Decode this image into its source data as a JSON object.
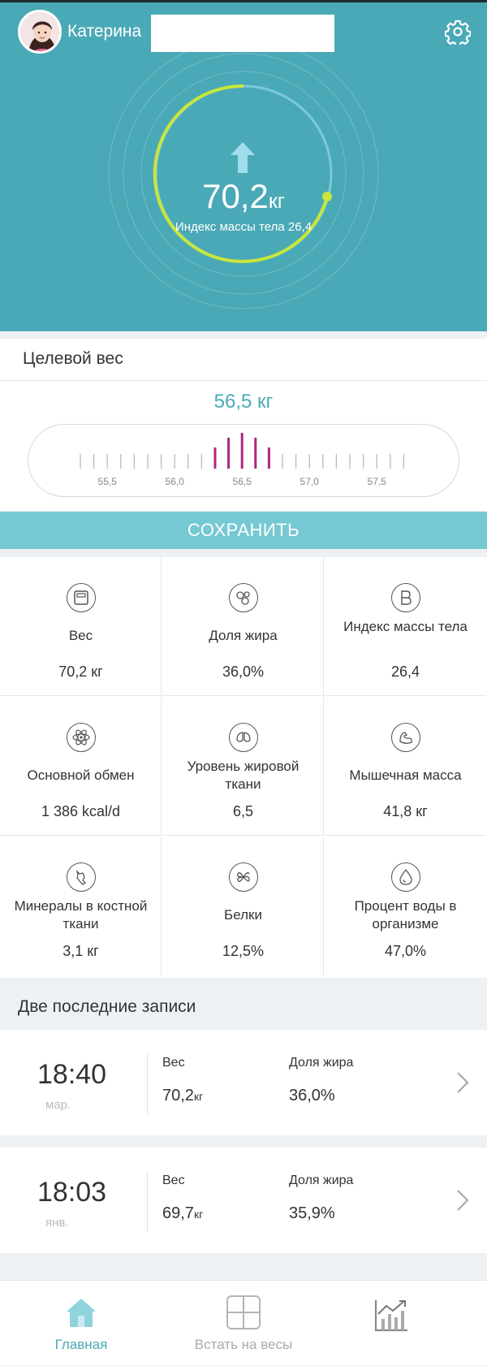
{
  "header": {
    "username": "Катерина",
    "settings_icon": "gear-icon"
  },
  "summary": {
    "weight_value": "70,2",
    "weight_unit": "кг",
    "bmi_label": "Индекс массы тела",
    "bmi_value": "26,4",
    "trend_icon": "arrow-up-icon"
  },
  "target": {
    "title": "Целевой вес",
    "value": "56,5 кг",
    "ruler_labels": [
      "55,5",
      "56,0",
      "56,5",
      "57,0",
      "57,5"
    ]
  },
  "save_button": "СОХРАНИТЬ",
  "metrics": [
    {
      "icon": "scale-icon",
      "label": "Вес",
      "value": "70,2 кг"
    },
    {
      "icon": "fat-icon",
      "label": "Доля жира",
      "value": "36,0%"
    },
    {
      "icon": "bmi-icon",
      "label": "Индекс массы тела",
      "value": "26,4"
    },
    {
      "icon": "metabolism-icon",
      "label": "Основной обмен",
      "value": "1 386 kcal/d"
    },
    {
      "icon": "visceral-fat-icon",
      "label": "Уровень жировой ткани",
      "value": "6,5"
    },
    {
      "icon": "muscle-icon",
      "label": "Мышечная масса",
      "value": "41,8 кг"
    },
    {
      "icon": "bone-icon",
      "label": "Минералы в костной ткани",
      "value": "3,1 кг"
    },
    {
      "icon": "protein-icon",
      "label": "Белки",
      "value": "12,5%"
    },
    {
      "icon": "water-icon",
      "label": "Процент воды в организме",
      "value": "47,0%"
    }
  ],
  "recent": {
    "title": "Две последние записи",
    "records": [
      {
        "time": "18:40",
        "date": "мар.",
        "weight_label": "Вес",
        "weight_value": "70,2",
        "weight_unit": "кг",
        "fat_label": "Доля жира",
        "fat_value": "36,0%"
      },
      {
        "time": "18:03",
        "date": "янв.",
        "weight_label": "Вес",
        "weight_value": "69,7",
        "weight_unit": "кг",
        "fat_label": "Доля жира",
        "fat_value": "35,9%"
      }
    ]
  },
  "tabs": [
    {
      "label": "Главная",
      "icon": "home-icon",
      "active": true
    },
    {
      "label": "Встать на весы",
      "icon": "scale-grid-icon",
      "active": false
    },
    {
      "label": "",
      "icon": "chart-icon",
      "active": false
    }
  ],
  "colors": {
    "brand": "#4aa9b6",
    "ring_green": "#c8e63c",
    "accent_magenta": "#b0257f",
    "save_button": "#76c9d3"
  }
}
